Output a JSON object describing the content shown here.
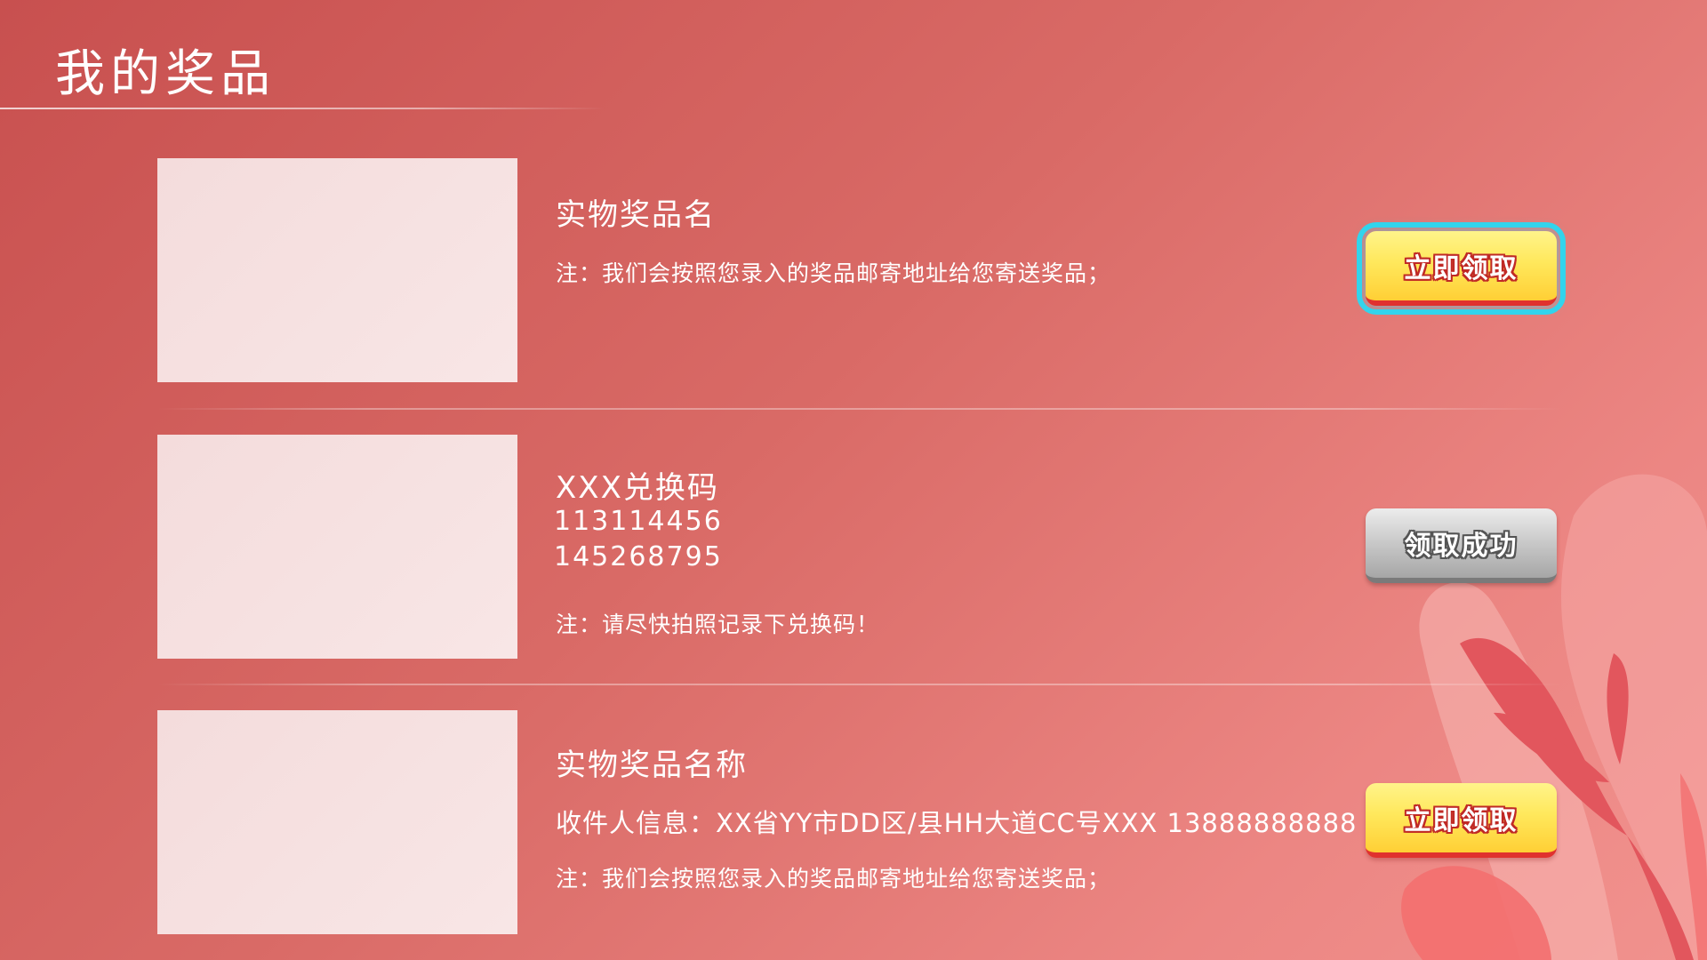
{
  "page": {
    "title": "我的奖品"
  },
  "prizes": [
    {
      "name": "实物奖品名",
      "note": "注：我们会按照您录入的奖品邮寄地址给您寄送奖品；",
      "button_label": "立即领取"
    },
    {
      "name": "XXX兑换码",
      "codes": [
        "113114456",
        "145268795"
      ],
      "note": "注：请尽快拍照记录下兑换码！",
      "button_label": "领取成功"
    },
    {
      "name": "实物奖品名称",
      "recipient": "收件人信息：XX省YY市DD区/县HH大道CC号XXX  13888888888",
      "note": "注：我们会按照您录入的奖品邮寄地址给您寄送奖品；",
      "button_label": "立即领取"
    }
  ],
  "colors": {
    "background_start": "#c8504f",
    "background_end": "#f1928e",
    "claim_button": "#ffe85c",
    "claim_button_border": "#e0312e",
    "claimed_button": "#c8c8c8",
    "focus_ring": "#32d4ec"
  },
  "icons": {
    "decoration": "leaf-decoration"
  }
}
